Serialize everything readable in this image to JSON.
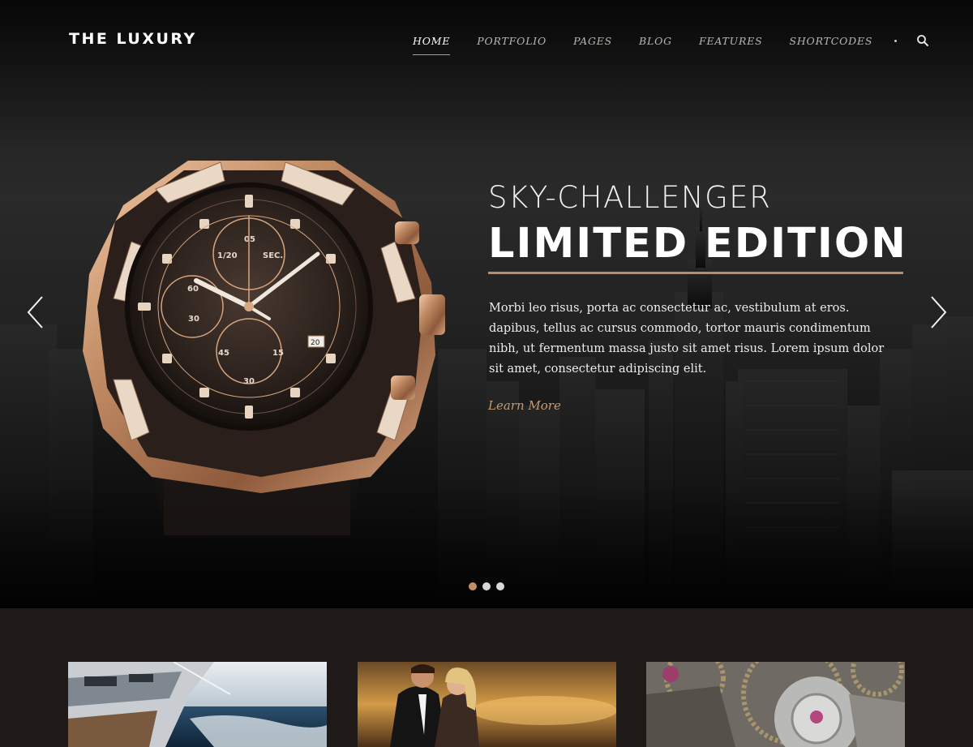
{
  "brand": {
    "logo": "THE LUXURY"
  },
  "nav": {
    "items": [
      {
        "label": "HOME",
        "active": true
      },
      {
        "label": "PORTFOLIO",
        "active": false
      },
      {
        "label": "PAGES",
        "active": false
      },
      {
        "label": "BLOG",
        "active": false
      },
      {
        "label": "FEATURES",
        "active": false
      },
      {
        "label": "SHORTCODES",
        "active": false
      }
    ],
    "search_icon": "search-icon"
  },
  "slider": {
    "subtitle": "SKY-CHALLENGER",
    "title": "LIMITED EDITION",
    "body": "Morbi leo risus, porta ac consectetur ac, vestibulum at eros. dapibus, tellus ac cursus commodo, tortor mauris condimentum nibh, ut fermentum massa justo sit amet risus. Lorem ipsum dolor sit amet, consectetur adipiscing elit.",
    "cta": "Learn More",
    "slide_count": 3,
    "active_slide": 1,
    "watch_labels": {
      "subdial_left_top": "1/20",
      "subdial_right_top": "SEC.",
      "left_sub_a": "60",
      "left_sub_b": "30",
      "bottom_sub_a": "45",
      "bottom_sub_b": "15",
      "bottom_sub_c": "30",
      "top_number": "05",
      "date": "20"
    }
  },
  "colors": {
    "accent": "#c39a73",
    "background": "#1f1a17"
  },
  "cards": [
    {
      "image": "yacht-photo"
    },
    {
      "image": "couple-photo"
    },
    {
      "image": "watch-mechanism-photo"
    }
  ]
}
